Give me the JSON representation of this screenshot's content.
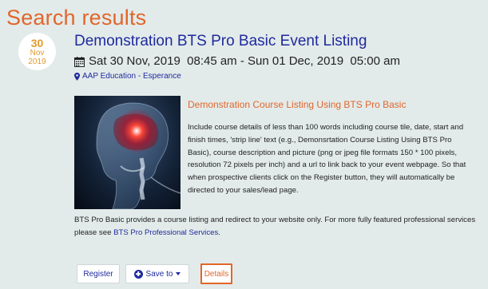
{
  "page": {
    "title": "Search results"
  },
  "event": {
    "date_badge": {
      "day": "30",
      "month": "Nov",
      "year": "2019"
    },
    "title": "Demonstration BTS Pro Basic Event Listing",
    "datetime": "Sat 30 Nov, 2019  08:45 am - Sun 01 Dec, 2019  05:00 am",
    "location": "AAP Education - Esperance",
    "course_title": "Demonstration Course Listing Using BTS Pro Basic",
    "course_description": "Include course details of less than 100 words including course tile, date, start and finish times, 'strip line' text (e.g., Demonsrtation Course Listing Using BTS Pro Basic), course description and picture (png or jpeg file formats 150 * 100 pixels, resolution 72 pixels per inch) and a url to link back to your event webpage. So that when prospective clients click on the Register button, they will automatically be directed to your sales/lead page.",
    "summary_text": "BTS Pro Basic provides a course listing and redirect to your website only. For more fully featured professional services please see ",
    "summary_link": "BTS Pro Professional Services",
    "summary_end": "."
  },
  "actions": {
    "register_label": "Register",
    "save_label": "Save to",
    "details_label": "Details"
  },
  "icons": {
    "datetime": "calendar-icon",
    "location": "map-pin-icon",
    "save": "plus-circle-icon",
    "save_dropdown": "caret-down-icon"
  },
  "colors": {
    "accent_orange": "#e1662b",
    "link_blue": "#1f2a9e",
    "background": "#e3ebea",
    "badge_text": "#e39a2c"
  }
}
